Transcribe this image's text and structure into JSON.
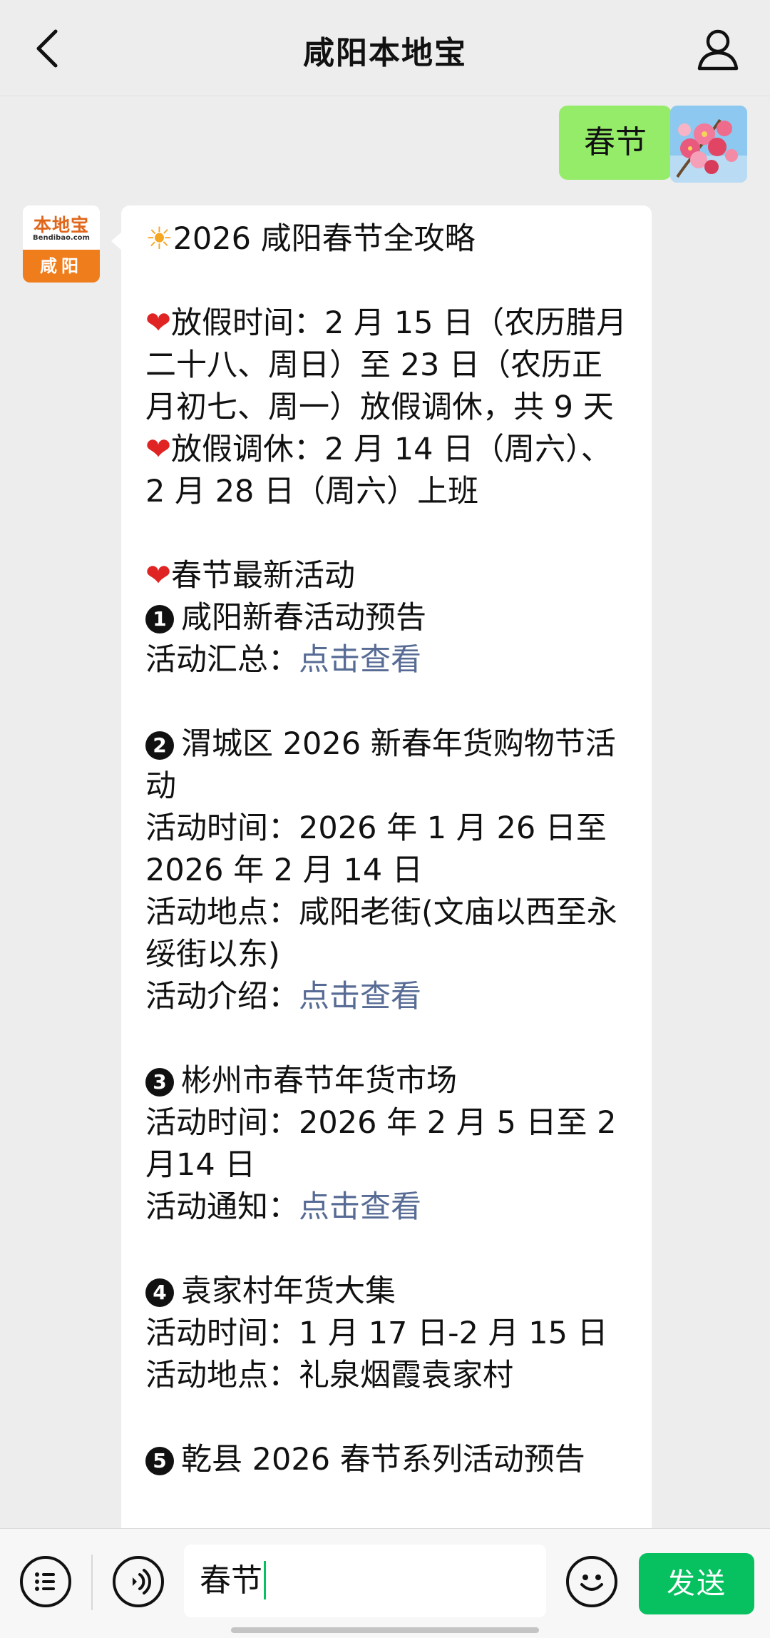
{
  "header": {
    "title": "咸阳本地宝",
    "back_icon": "chevron-left-icon",
    "profile_icon": "person-icon"
  },
  "user_message": {
    "text": "春节",
    "avatar": "flower-photo"
  },
  "bot": {
    "avatar_brand": "本地宝",
    "avatar_domain": "Bendibao.com",
    "avatar_city": "咸阳",
    "sections": {
      "title": "2026 咸阳春节全攻略",
      "holiday_label": "放假时间：",
      "holiday_text": "2 月 15 日（农历腊月二十八、周日）至 23 日（农历正月初七、周一）放假调休，共 9 天",
      "makeup_label": "放假调休：",
      "makeup_text": "2 月 14 日（周六）、2 月 28 日（周六）上班",
      "activities_title": "春节最新活动",
      "a1_num": "1",
      "a1_title": "咸阳新春活动预告",
      "a1_l1_label": "活动汇总：",
      "a1_l1_link": "点击查看",
      "a2_num": "2",
      "a2_title": "渭城区 2026 新春年货购物节活动",
      "a2_time": "活动时间：2026 年 1 月 26 日至 2026 年 2 月 14 日",
      "a2_place": "活动地点：咸阳老街(文庙以西至永绥街以东)",
      "a2_intro_label": "活动介绍：",
      "a2_intro_link": "点击查看",
      "a3_num": "3",
      "a3_title": "彬州市春节年货市场",
      "a3_time": "活动时间：2026 年 2 月 5 日至 2 月14 日",
      "a3_notice_label": "活动通知：",
      "a3_notice_link": "点击查看",
      "a4_num": "4",
      "a4_title": "袁家村年货大集",
      "a4_time": "活动时间：1 月 17 日-2 月 15 日",
      "a4_place": "活动地点：礼泉烟霞袁家村",
      "a5_num": "5",
      "a5_title": "乾县 2026 春节系列活动预告"
    }
  },
  "input_bar": {
    "value": "春节",
    "send_label": "发送",
    "menu_icon": "list-menu-icon",
    "voice_icon": "voice-icon",
    "emoji_icon": "emoji-icon"
  },
  "colors": {
    "user_bubble": "#95ec69",
    "send_button": "#07c160",
    "link": "#576b95",
    "heart": "#e02424"
  }
}
